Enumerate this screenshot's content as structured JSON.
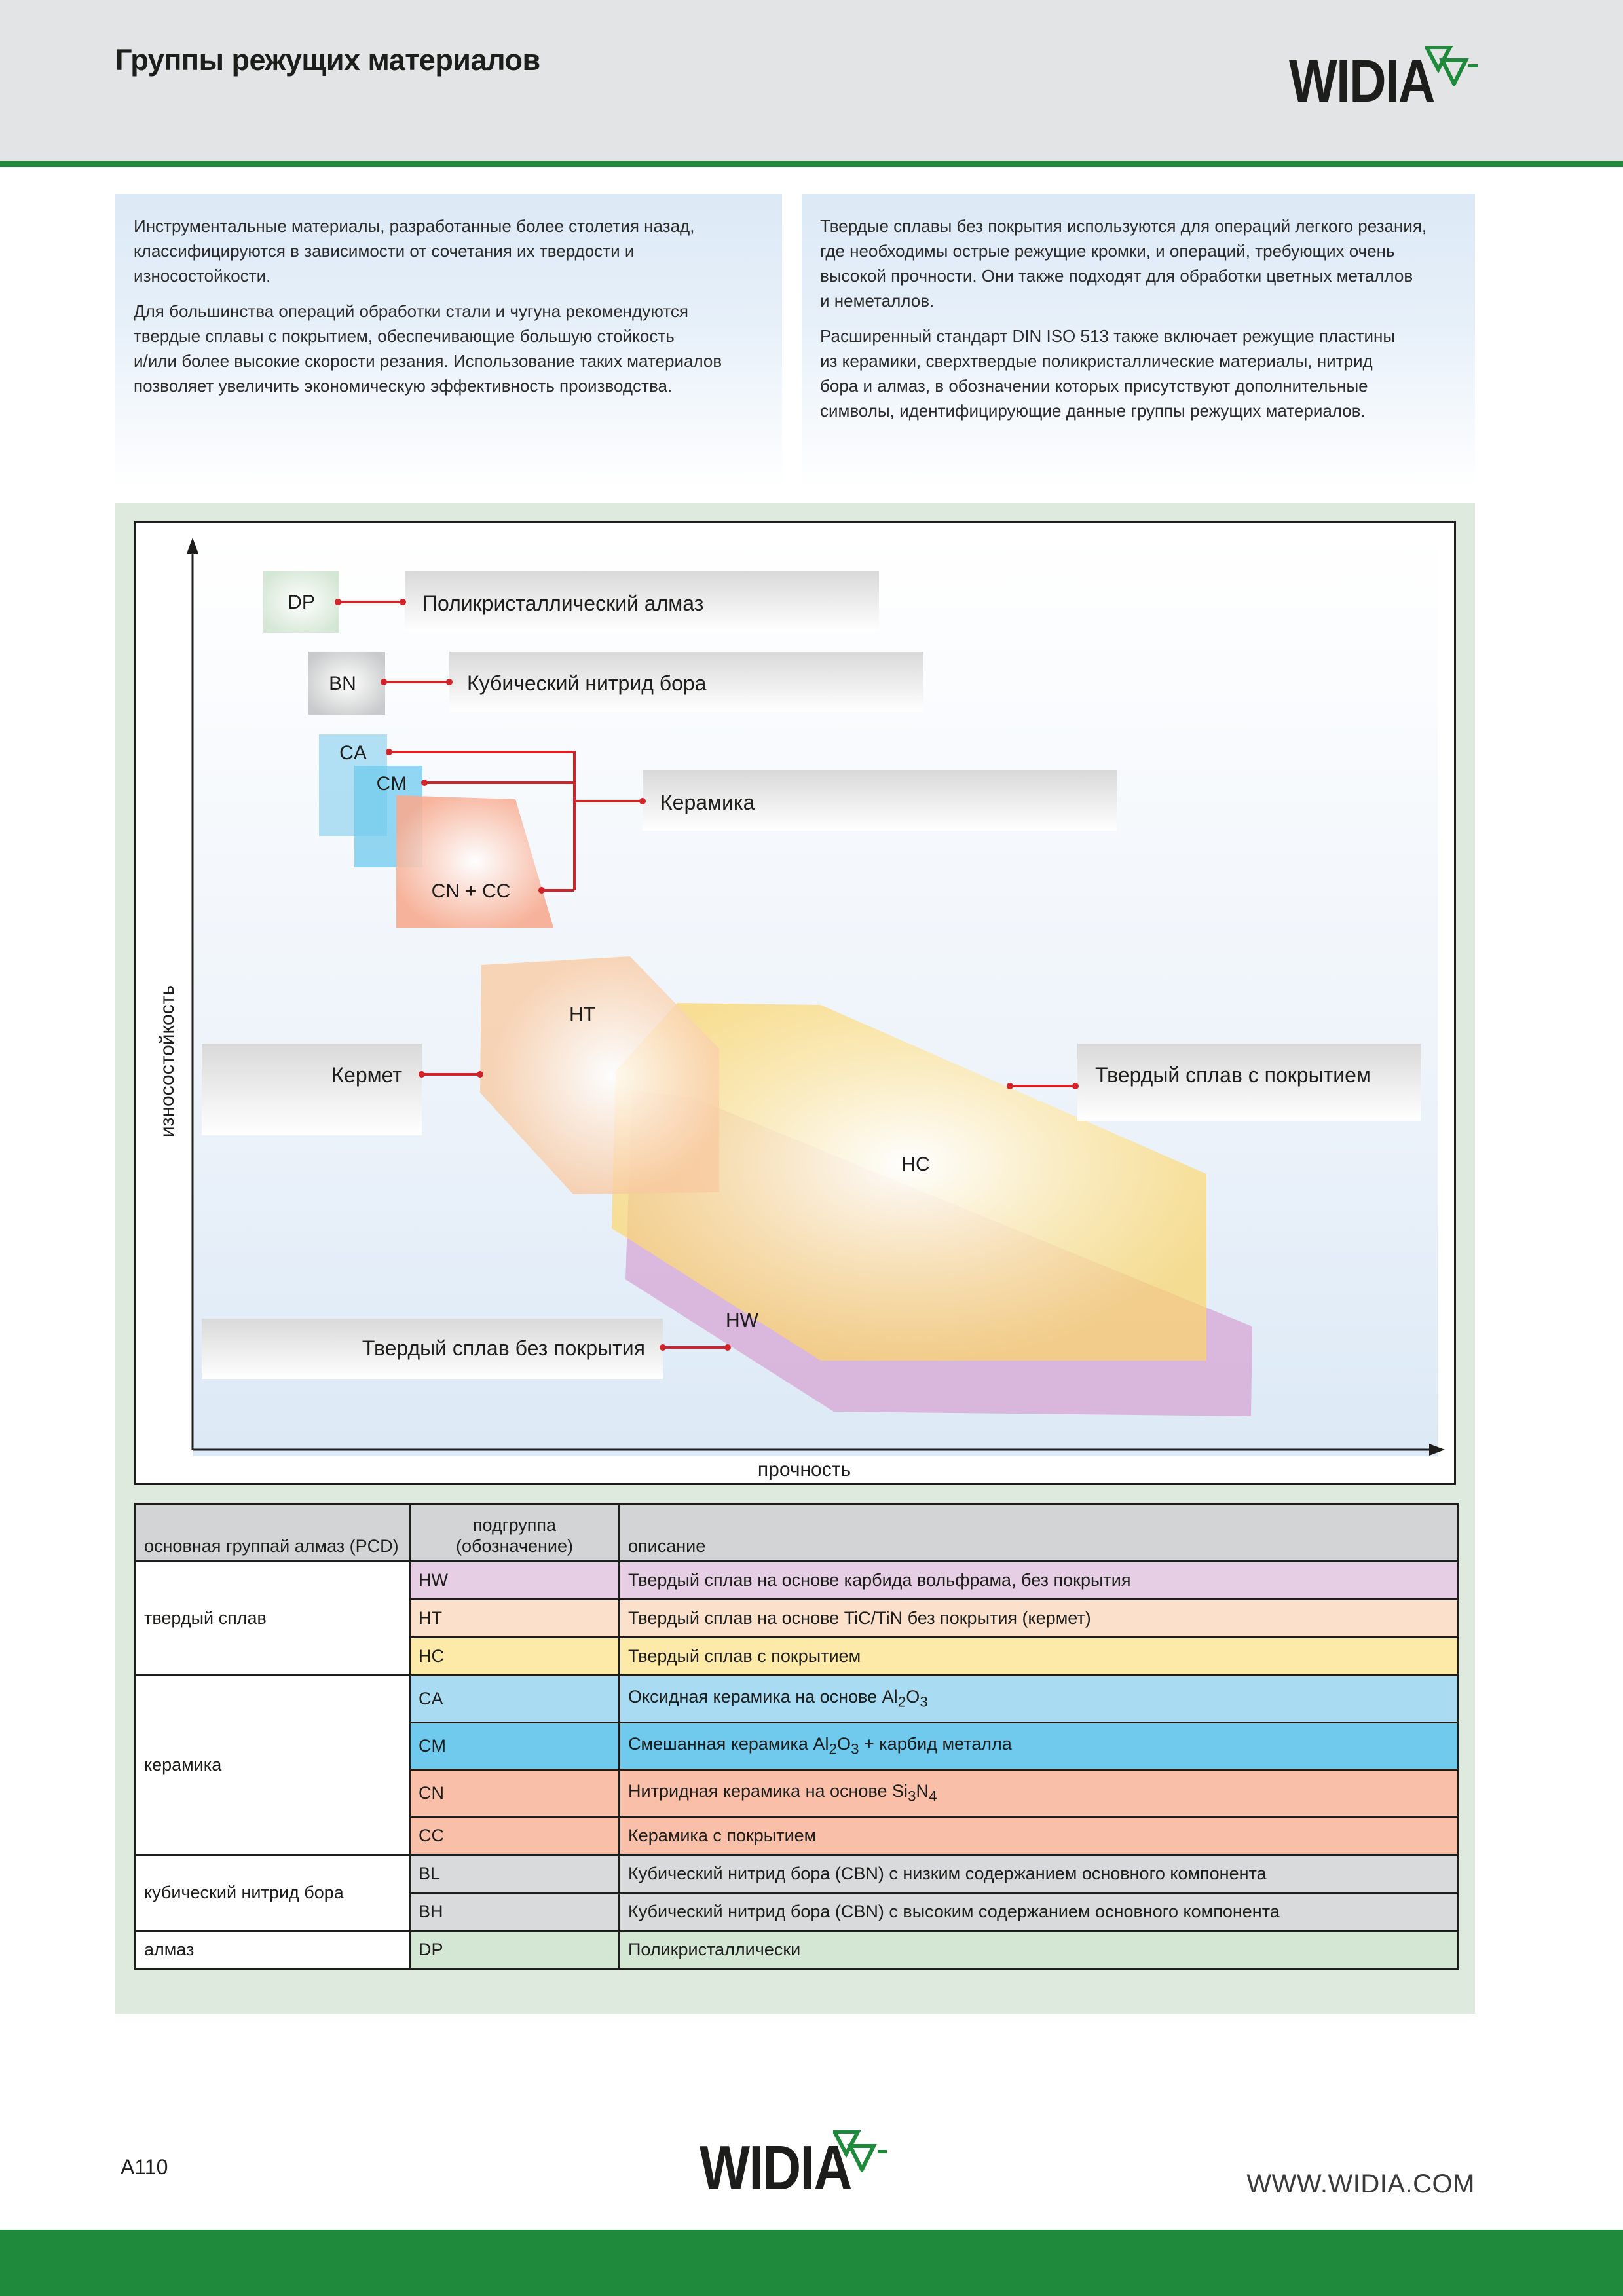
{
  "header": {
    "title": "Группы режущих материалов",
    "logo_text": "WIDIA"
  },
  "intro": {
    "left": [
      "Инструментальные материалы, разработанные более столетия назад,\nклассифицируются в зависимости от сочетания их твердости и износостойкости.",
      "Для большинства операций обработки стали и чугуна рекомендуются\nтвердые сплавы с покрытием, обеспечивающие большую стойкость\nи/или более высокие скорости резания. Использование таких материалов\nпозволяет увеличить экономическую эффективность производства."
    ],
    "right": [
      "Твердые сплавы без покрытия используются для операций легкого резания,\nгде необходимы острые режущие кромки, и операций, требующих очень\nвысокой прочности. Они также подходят  для обработки цветных металлов\nи неметаллов.",
      "Расширенный стандарт DIN ISO 513 также включает режущие пластины\nиз керамики, сверхтвердые поликристаллические материалы, нитрид\nбора и алмаз, в обозначении которых присутствуют дополнительные\nсимволы, идентифицирующие данные группы режущих материалов."
    ]
  },
  "diagram": {
    "y_axis_label": "износостойкость",
    "x_axis_label": "прочность",
    "regions": {
      "dp": "DP",
      "bn": "BN",
      "ca": "CA",
      "cm": "CM",
      "cn_cc": "CN + CC",
      "ht": "HT",
      "hc": "HC",
      "hw": "HW"
    },
    "callouts": {
      "dp": "Поликристаллический алмаз",
      "bn": "Кубический нитрид бора",
      "ceramic": "Керамика",
      "cermet": "Кермет",
      "coated": "Твердый сплав с покрытием",
      "uncoated": "Твердый сплав без покрытия"
    },
    "colors": {
      "connector": "#d2232a",
      "dp": "#d4e6d4",
      "bn": "#c9cacb",
      "ca": "#a9dcf3",
      "cm": "#6fcaee",
      "cn_cc": "#f7ab90",
      "ht": "#f9c9a0",
      "hc": "#fbd56a",
      "hw": "#d7a6d4"
    }
  },
  "table": {
    "headers": {
      "group": "основная группай алмаз (PCD)",
      "subgroup_line1": "подгруппа",
      "subgroup_line2": "(обозначение)",
      "description": "описание"
    },
    "groups": {
      "hard_alloy": "твердый сплав",
      "ceramic": "керамика",
      "cbn": "кубический нитрид бора",
      "diamond": "алмаз"
    },
    "rows": {
      "hw": {
        "code": "HW",
        "desc": "Твердый сплав на основе карбида вольфрама, без покрытия"
      },
      "ht": {
        "code": "HT",
        "desc": "Твердый сплав на основе TiC/TiN без покрытия (кермет)"
      },
      "hc": {
        "code": "HC",
        "desc": "Твердый сплав с покрытием"
      },
      "ca": {
        "code": "CA",
        "desc_a": "Оксидная керамика на основе Al",
        "sub1": "2",
        "desc_b": "O",
        "sub2": "3"
      },
      "cm": {
        "code": "CM",
        "desc_a": "Смешанная керамика Al",
        "sub1": "2",
        "desc_b": "O",
        "sub2": "3",
        "desc_c": " + карбид металла"
      },
      "cn": {
        "code": "CN",
        "desc_a": "Нитридная керамика на основе Si",
        "sub1": "3",
        "desc_b": "N",
        "sub2": "4"
      },
      "cc": {
        "code": "CC",
        "desc": "Керамика с покрытием"
      },
      "bl": {
        "code": "BL",
        "desc": "Кубический нитрид бора (CBN) с низким содержанием основного компонента"
      },
      "bh": {
        "code": "BH",
        "desc": "Кубический нитрид бора (CBN) с высоким содержанием основного компонента"
      },
      "dp": {
        "code": "DP",
        "desc": "Поликристаллически"
      }
    }
  },
  "footer": {
    "page_number": "A110",
    "logo_text": "WIDIA",
    "website": "WWW.WIDIA.COM"
  }
}
